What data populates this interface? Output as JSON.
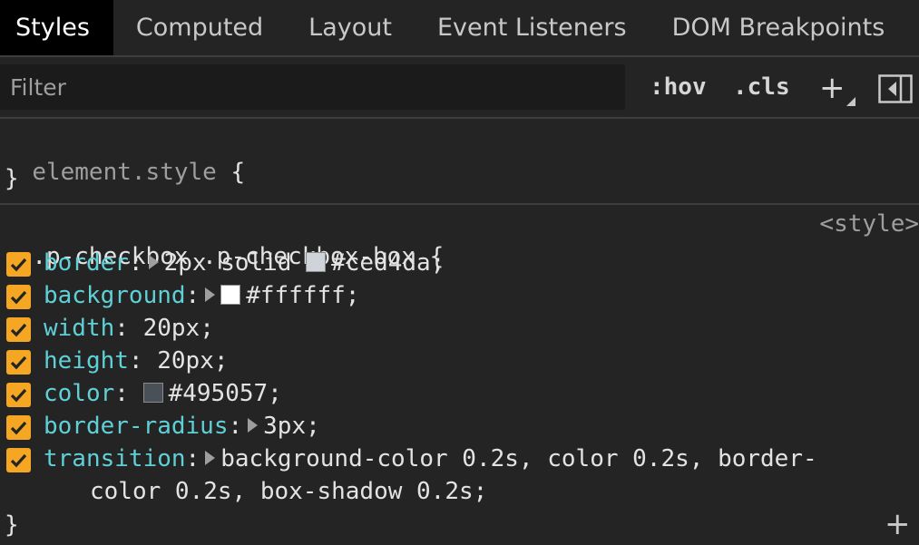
{
  "tabs": [
    {
      "label": "Styles",
      "active": true
    },
    {
      "label": "Computed"
    },
    {
      "label": "Layout"
    },
    {
      "label": "Event Listeners"
    },
    {
      "label": "DOM Breakpoints"
    }
  ],
  "tabs_overflow": "»",
  "toolbar": {
    "filter_placeholder": "Filter",
    "hov_label": ":hov",
    "cls_label": ".cls",
    "add_rule_label": "+"
  },
  "element_style": {
    "selector": "element.style",
    "open_brace": " {",
    "close_brace": "}"
  },
  "rule": {
    "selector": ".p-checkbox .p-checkbox-box",
    "open_brace": " {",
    "close_brace": "}",
    "source": "<style>",
    "declarations": [
      {
        "name": "border",
        "value": "2px solid ",
        "color": "#ced4da",
        "has_expand": true
      },
      {
        "name": "background",
        "value": "",
        "color": "#ffffff",
        "has_expand": true
      },
      {
        "name": "width",
        "value": "20px"
      },
      {
        "name": "height",
        "value": "20px"
      },
      {
        "name": "color",
        "value": "",
        "color": "#495057"
      },
      {
        "name": "border-radius",
        "value": "3px",
        "has_expand": true
      },
      {
        "name": "transition",
        "value": "background-color 0.2s, color 0.2s, border-",
        "value_cont": "color 0.2s, box-shadow 0.2s;",
        "has_expand": true
      }
    ]
  },
  "colors": {
    "checkbox": "#f5a623",
    "property_name": "#5fd0d6"
  }
}
